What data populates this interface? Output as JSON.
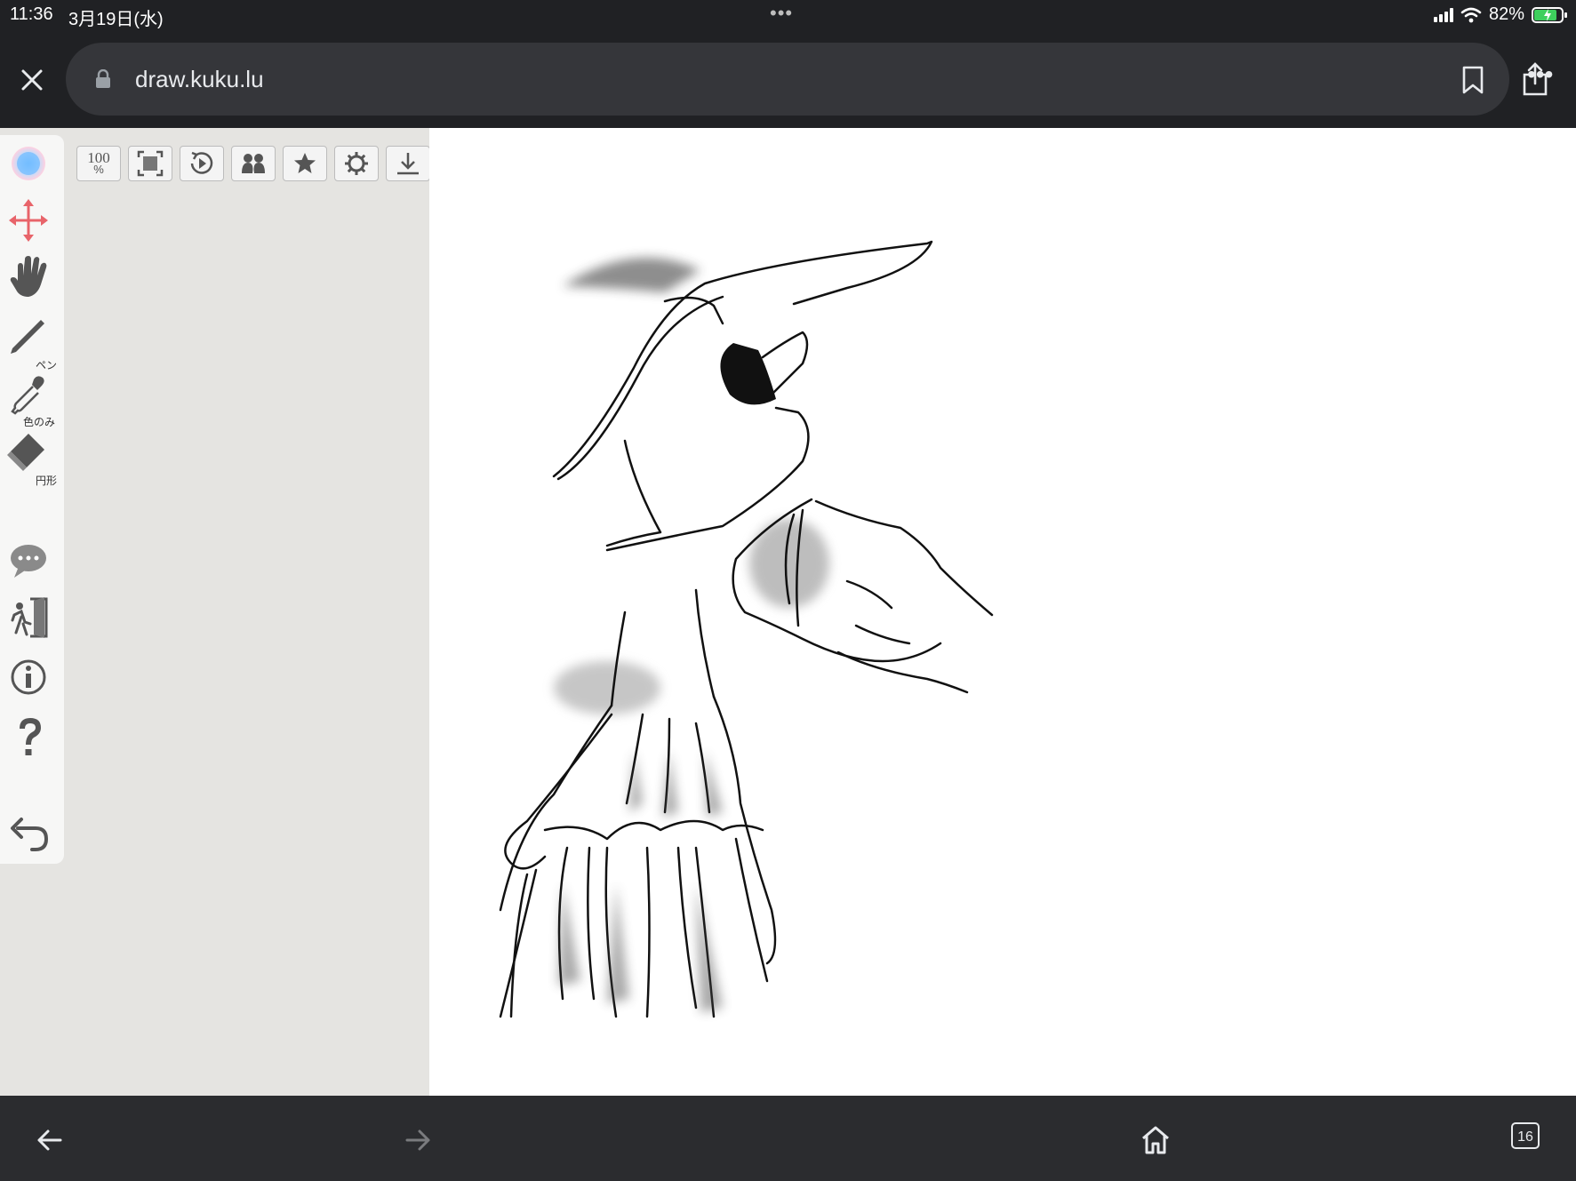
{
  "status_bar": {
    "time": "11:36",
    "date": "3月19日(水)",
    "multitask_dots": "•••",
    "battery_percent": "82%",
    "battery_level": 0.82,
    "charging": true
  },
  "browser": {
    "url": "draw.kuku.lu",
    "more_label": "•••",
    "tab_count": "16"
  },
  "tools": {
    "pen_label": "ペン",
    "eyedropper_label": "色のみ",
    "eraser_label": "円形"
  },
  "toolbar_buttons": {
    "zoom_top": "100",
    "zoom_bottom": "%"
  },
  "colors": {
    "chrome_bg": "#202124",
    "url_bg": "#35363a",
    "panel_bg": "#e5e4e1",
    "move_tool_accent": "#e8646a"
  }
}
